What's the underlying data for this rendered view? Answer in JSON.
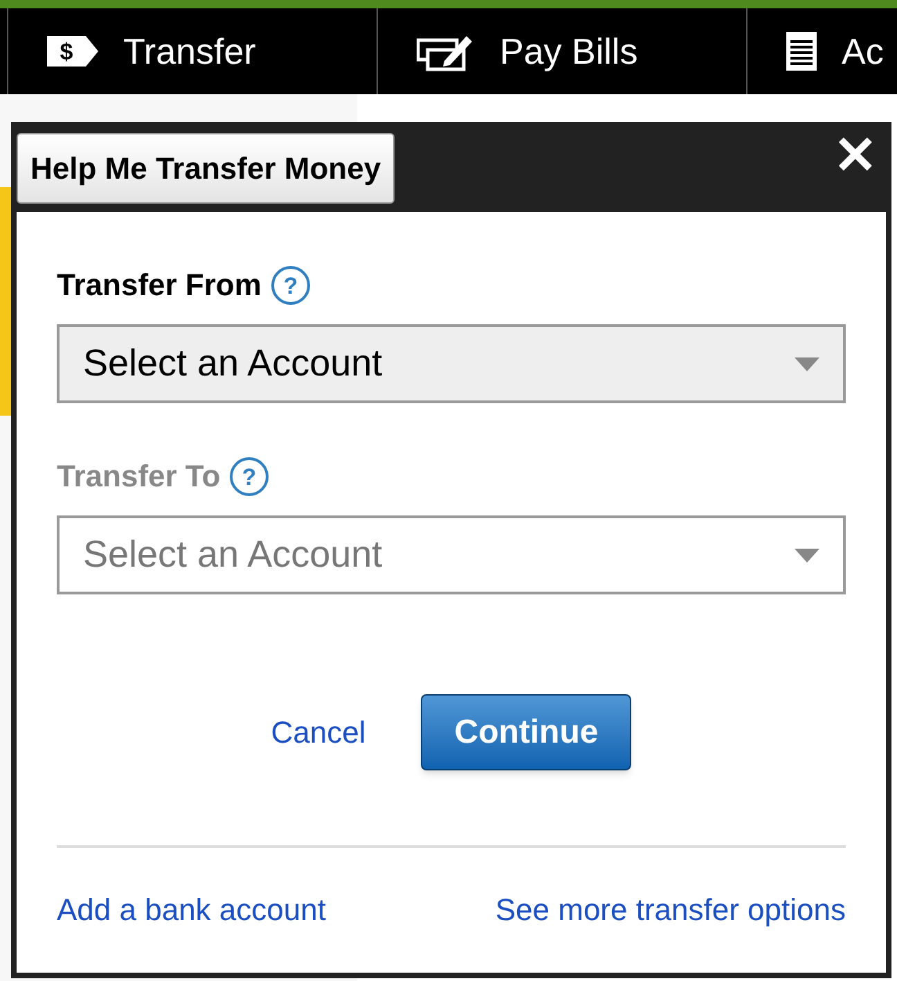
{
  "nav": [
    {
      "label": "Transfer",
      "kind": "tag",
      "icon_text": "$"
    },
    {
      "label": "Pay Bills",
      "kind": "pen"
    },
    {
      "label": "Ac",
      "kind": "notepad"
    }
  ],
  "dialog": {
    "title": "Help Me Transfer Money",
    "close": "✕",
    "fields": [
      {
        "label": "Transfer From",
        "help": "?",
        "value": "Select an Account",
        "disabled": false
      },
      {
        "label": "Transfer To",
        "help": "?",
        "value": "Select an Account",
        "disabled": true
      }
    ],
    "cancel": "Cancel",
    "continue": "Continue",
    "links": [
      "Add a bank account",
      "See more transfer options"
    ]
  }
}
